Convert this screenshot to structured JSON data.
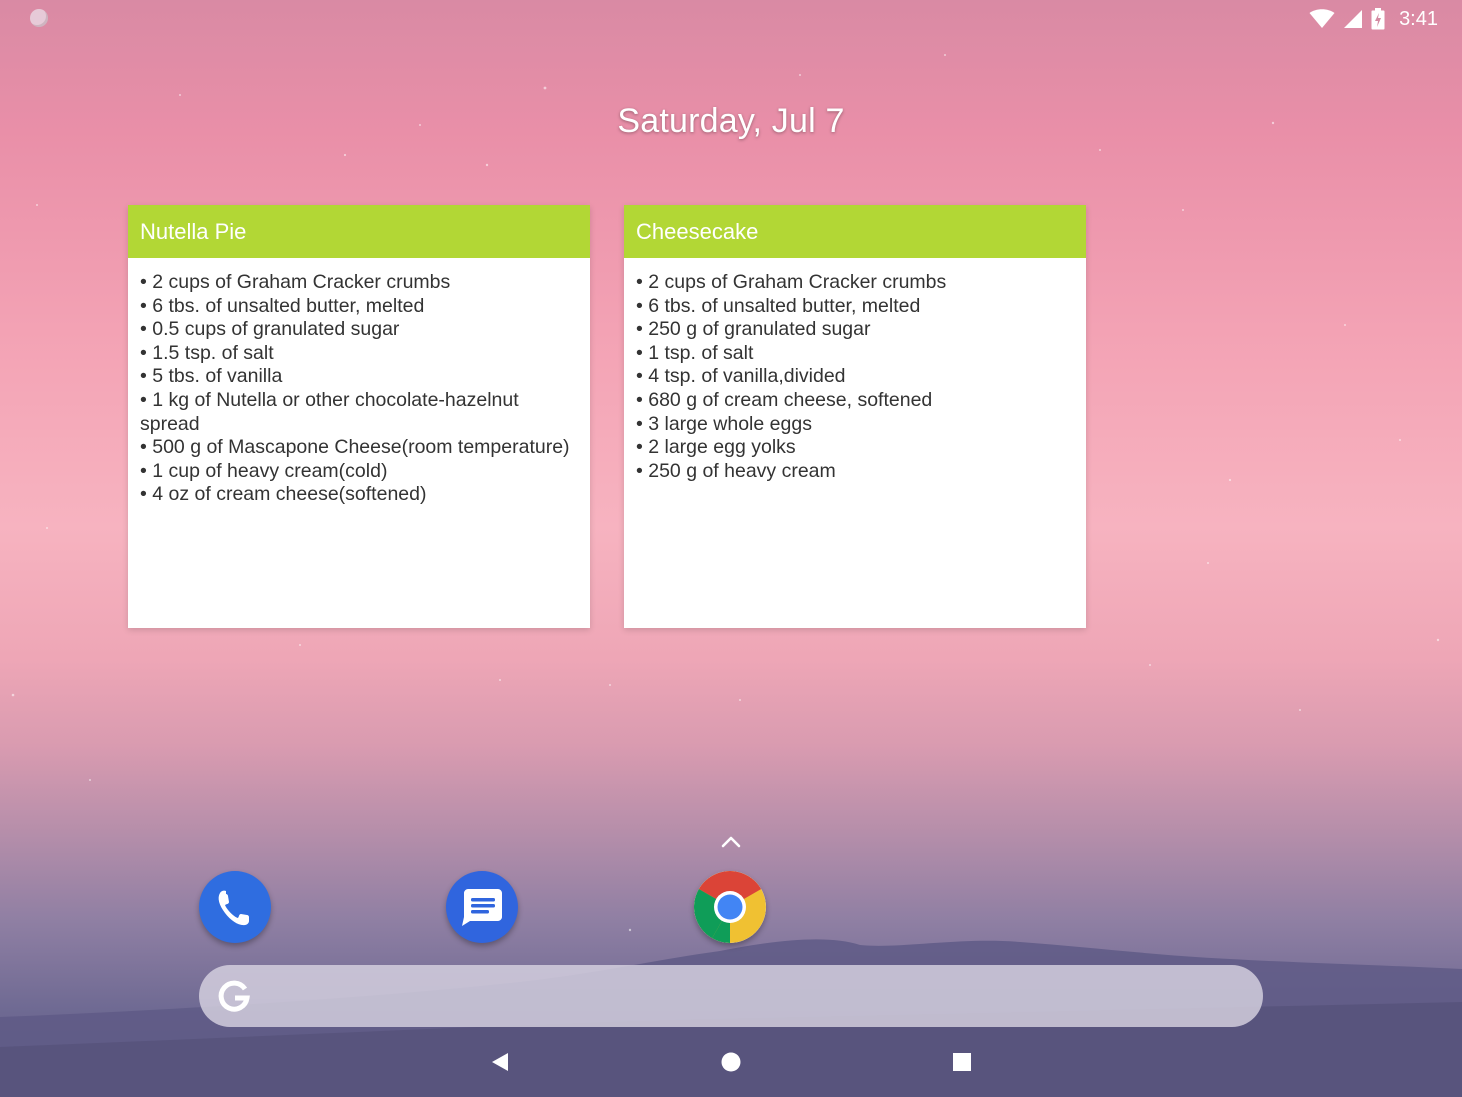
{
  "status_bar": {
    "time": "3:41",
    "icons": [
      "notification-dot-icon",
      "wifi-icon",
      "cell-signal-icon",
      "battery-charging-icon"
    ]
  },
  "date": "Saturday, Jul 7",
  "widgets": [
    {
      "title": "Nutella Pie",
      "ingredients": [
        "• 2 cups of Graham Cracker crumbs",
        "• 6 tbs. of unsalted butter, melted",
        "• 0.5 cups of granulated sugar",
        "• 1.5 tsp. of salt",
        "• 5 tbs. of vanilla",
        "• 1 kg of Nutella or other chocolate-hazelnut spread",
        "• 500 g of Mascapone Cheese(room temperature)",
        "• 1 cup of heavy cream(cold)",
        "• 4 oz of cream cheese(softened)"
      ]
    },
    {
      "title": "Cheesecake",
      "ingredients": [
        "• 2 cups of Graham Cracker crumbs",
        "• 6 tbs. of unsalted butter, melted",
        "• 250 g of granulated sugar",
        "• 1 tsp. of salt",
        "• 4 tsp. of vanilla,divided",
        "• 680 g of cream cheese, softened",
        "• 3 large whole eggs",
        "• 2 large egg yolks",
        "• 250 g of heavy cream"
      ]
    }
  ],
  "dock": {
    "apps": [
      "phone-icon",
      "messages-icon",
      "chrome-icon"
    ],
    "app_drawer_icon": "chevron-up-icon"
  },
  "search": {
    "logo": "google-g-icon",
    "value": ""
  },
  "nav": [
    "back-icon",
    "home-icon",
    "recents-icon"
  ],
  "colors": {
    "widget_header": "#b2d735",
    "widget_body": "#ffffff",
    "phone": "#2f6de0",
    "messages": "#3065de"
  }
}
